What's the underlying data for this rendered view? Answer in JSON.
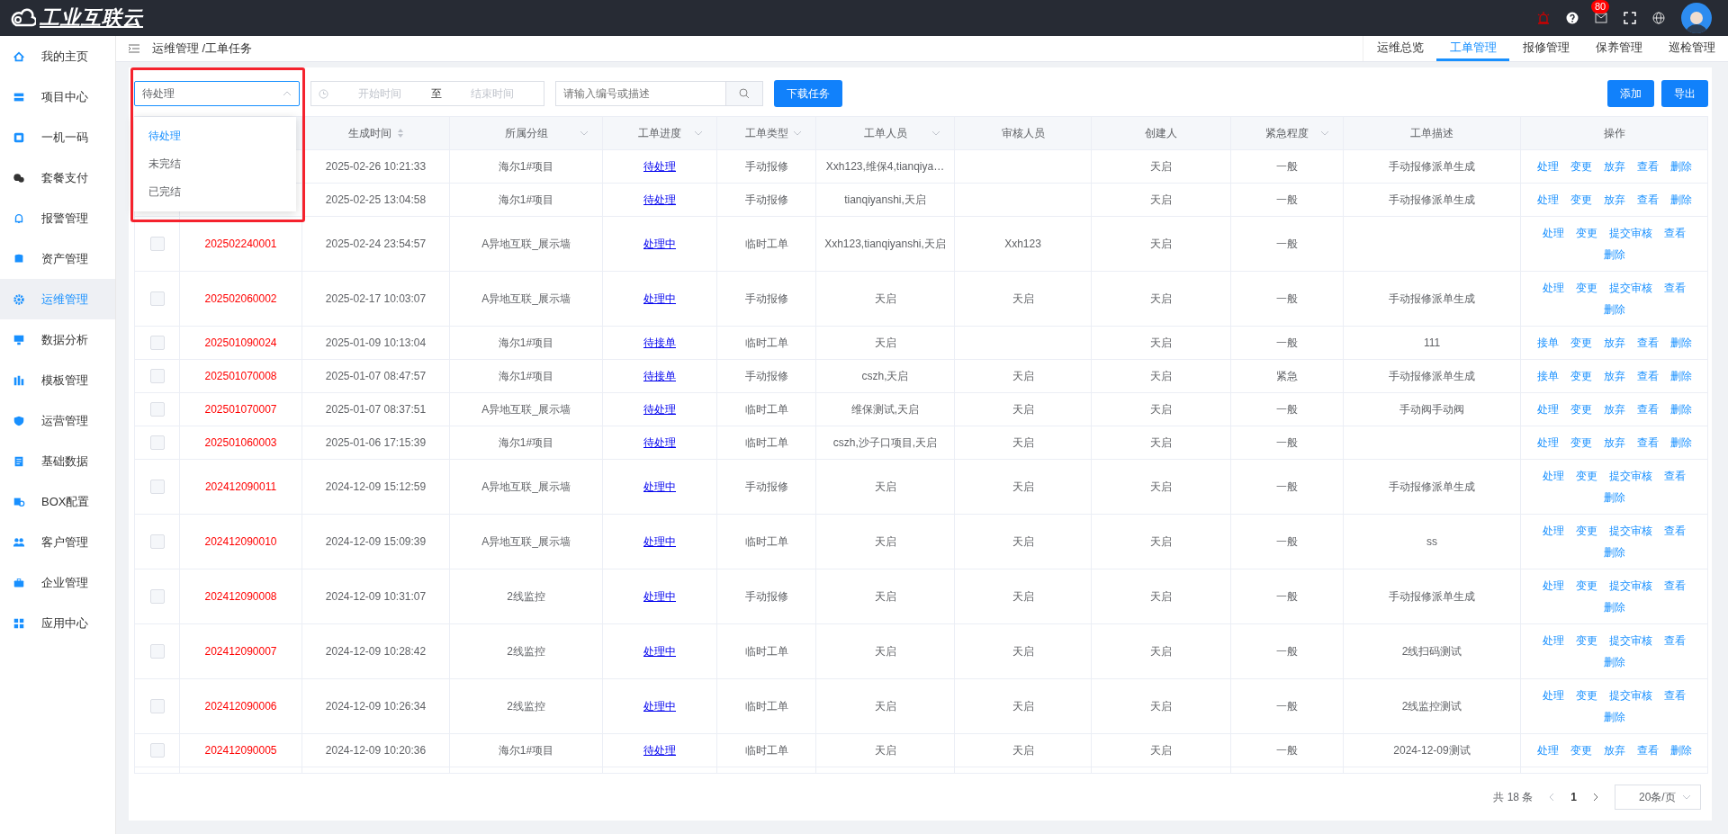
{
  "topbar": {
    "logo_text": "工业互联云",
    "mail_badge": "80"
  },
  "sidebar": {
    "items": [
      {
        "label": "我的主页",
        "selected": false
      },
      {
        "label": "项目中心",
        "selected": false
      },
      {
        "label": "一机一码",
        "selected": false
      },
      {
        "label": "套餐支付",
        "selected": false
      },
      {
        "label": "报警管理",
        "selected": false
      },
      {
        "label": "资产管理",
        "selected": false
      },
      {
        "label": "运维管理",
        "selected": true
      },
      {
        "label": "数据分析",
        "selected": false
      },
      {
        "label": "模板管理",
        "selected": false
      },
      {
        "label": "运营管理",
        "selected": false
      },
      {
        "label": "基础数据",
        "selected": false
      },
      {
        "label": "BOX配置",
        "selected": false
      },
      {
        "label": "客户管理",
        "selected": false
      },
      {
        "label": "企业管理",
        "selected": false
      },
      {
        "label": "应用中心",
        "selected": false
      }
    ]
  },
  "breadcrumb": "运维管理 /工单任务",
  "tabs": [
    {
      "label": "运维总览",
      "selected": false
    },
    {
      "label": "工单管理",
      "selected": true
    },
    {
      "label": "报修管理",
      "selected": false
    },
    {
      "label": "保养管理",
      "selected": false
    },
    {
      "label": "巡检管理",
      "selected": false
    }
  ],
  "filters": {
    "status_select": {
      "value": "待处理",
      "expanded": true,
      "highlighted": true,
      "options": [
        {
          "label": "待处理",
          "selected": true
        },
        {
          "label": "未完结",
          "selected": false
        },
        {
          "label": "已完结",
          "selected": false
        }
      ]
    },
    "date_range": {
      "start_placeholder": "开始时间",
      "separator": "至",
      "end_placeholder": "结束时间"
    },
    "search": {
      "placeholder": "请输入编号或描述"
    },
    "download_button": "下载任务",
    "add_button": "添加",
    "export_button": "导出"
  },
  "table": {
    "columns": [
      {
        "label": "生成时间",
        "sortable": true
      },
      {
        "label": "所属分组",
        "filter": true
      },
      {
        "label": "工单进度",
        "filter": true
      },
      {
        "label": "工单类型",
        "filter": true
      },
      {
        "label": "工单人员",
        "filter": true
      },
      {
        "label": "审核人员"
      },
      {
        "label": "创建人"
      },
      {
        "label": "紧急程度",
        "filter": true
      },
      {
        "label": "工单描述"
      },
      {
        "label": "操作"
      }
    ],
    "rows": [
      {
        "time": "2025-02-26 10:21:33",
        "group": "海尔1#项目",
        "progress": "待处理",
        "type": "手动报修",
        "personnel": "Xxh123,维保4,tianqiya…",
        "creator": "天启",
        "urgency": "一般",
        "description": "手动报修派单生成",
        "actions": [
          "处理",
          "变更",
          "放弃",
          "查看",
          "删除"
        ]
      },
      {
        "time": "2025-02-25 13:04:58",
        "group": "海尔1#项目",
        "progress": "待处理",
        "type": "手动报修",
        "personnel": "tianqiyanshi,天启",
        "creator": "天启",
        "urgency": "一般",
        "description": "手动报修派单生成",
        "actions": [
          "处理",
          "变更",
          "放弃",
          "查看",
          "删除"
        ]
      },
      {
        "checked": false,
        "id": "202502240001",
        "time": "2025-02-24 23:54:57",
        "group": "A异地互联_展示墙",
        "progress": "处理中",
        "type": "临时工单",
        "personnel": "Xxh123,tianqiyanshi,天启",
        "reviewer": "Xxh123",
        "creator": "天启",
        "urgency": "一般",
        "actions": [
          "处理",
          "变更",
          "提交审核",
          "查看",
          "删除"
        ]
      },
      {
        "checked": false,
        "id": "202502060002",
        "time": "2025-02-17 10:03:07",
        "group": "A异地互联_展示墙",
        "progress": "处理中",
        "type": "手动报修",
        "personnel": "天启",
        "reviewer": "天启",
        "creator": "天启",
        "urgency": "一般",
        "description": "手动报修派单生成",
        "actions": [
          "处理",
          "变更",
          "提交审核",
          "查看",
          "删除"
        ]
      },
      {
        "checked": false,
        "id": "202501090024",
        "time": "2025-01-09 10:13:04",
        "group": "海尔1#项目",
        "progress": "待接单",
        "type": "临时工单",
        "personnel": "天启",
        "creator": "天启",
        "urgency": "一般",
        "description": "111",
        "actions": [
          "接单",
          "变更",
          "放弃",
          "查看",
          "删除"
        ]
      },
      {
        "checked": false,
        "id": "202501070008",
        "time": "2025-01-07 08:47:57",
        "group": "海尔1#项目",
        "progress": "待接单",
        "type": "手动报修",
        "personnel": "cszh,天启",
        "reviewer": "天启",
        "creator": "天启",
        "urgency": "紧急",
        "description": "手动报修派单生成",
        "actions": [
          "接单",
          "变更",
          "放弃",
          "查看",
          "删除"
        ]
      },
      {
        "checked": false,
        "id": "202501070007",
        "time": "2025-01-07 08:37:51",
        "group": "A异地互联_展示墙",
        "progress": "待处理",
        "type": "临时工单",
        "personnel": "维保测试,天启",
        "reviewer": "天启",
        "creator": "天启",
        "urgency": "一般",
        "description": "手动阀手动阀",
        "actions": [
          "处理",
          "变更",
          "放弃",
          "查看",
          "删除"
        ]
      },
      {
        "checked": false,
        "id": "202501060003",
        "time": "2025-01-06 17:15:39",
        "group": "海尔1#项目",
        "progress": "待处理",
        "type": "临时工单",
        "personnel": "cszh,沙子口项目,天启",
        "reviewer": "天启",
        "creator": "天启",
        "urgency": "一般",
        "actions": [
          "处理",
          "变更",
          "放弃",
          "查看",
          "删除"
        ]
      },
      {
        "checked": false,
        "id": "202412090011",
        "time": "2024-12-09 15:12:59",
        "group": "A异地互联_展示墙",
        "progress": "处理中",
        "type": "手动报修",
        "personnel": "天启",
        "reviewer": "天启",
        "creator": "天启",
        "urgency": "一般",
        "description": "手动报修派单生成",
        "actions": [
          "处理",
          "变更",
          "提交审核",
          "查看",
          "删除"
        ]
      },
      {
        "checked": false,
        "id": "202412090010",
        "time": "2024-12-09 15:09:39",
        "group": "A异地互联_展示墙",
        "progress": "处理中",
        "type": "临时工单",
        "personnel": "天启",
        "reviewer": "天启",
        "creator": "天启",
        "urgency": "一般",
        "description": "ss",
        "actions": [
          "处理",
          "变更",
          "提交审核",
          "查看",
          "删除"
        ]
      },
      {
        "checked": false,
        "id": "202412090008",
        "time": "2024-12-09 10:31:07",
        "group": "2线监控",
        "progress": "处理中",
        "type": "手动报修",
        "personnel": "天启",
        "reviewer": "天启",
        "creator": "天启",
        "urgency": "一般",
        "description": "手动报修派单生成",
        "actions": [
          "处理",
          "变更",
          "提交审核",
          "查看",
          "删除"
        ]
      },
      {
        "checked": false,
        "id": "202412090007",
        "time": "2024-12-09 10:28:42",
        "group": "2线监控",
        "progress": "处理中",
        "type": "临时工单",
        "personnel": "天启",
        "reviewer": "天启",
        "creator": "天启",
        "urgency": "一般",
        "description": "2线扫码测试",
        "actions": [
          "处理",
          "变更",
          "提交审核",
          "查看",
          "删除"
        ]
      },
      {
        "checked": false,
        "id": "202412090006",
        "time": "2024-12-09 10:26:34",
        "group": "2线监控",
        "progress": "处理中",
        "type": "临时工单",
        "personnel": "天启",
        "reviewer": "天启",
        "creator": "天启",
        "urgency": "一般",
        "description": "2线监控测试",
        "actions": [
          "处理",
          "变更",
          "提交审核",
          "查看",
          "删除"
        ]
      },
      {
        "checked": false,
        "id": "202412090005",
        "time": "2024-12-09 10:20:36",
        "group": "海尔1#项目",
        "progress": "待处理",
        "type": "临时工单",
        "personnel": "天启",
        "reviewer": "天启",
        "creator": "天启",
        "urgency": "一般",
        "description": "2024-12-09测试",
        "actions": [
          "处理",
          "变更",
          "放弃",
          "查看",
          "删除"
        ]
      }
    ]
  },
  "pagination": {
    "total": "共 18 条",
    "page": "1",
    "page_size": "20条/页"
  }
}
